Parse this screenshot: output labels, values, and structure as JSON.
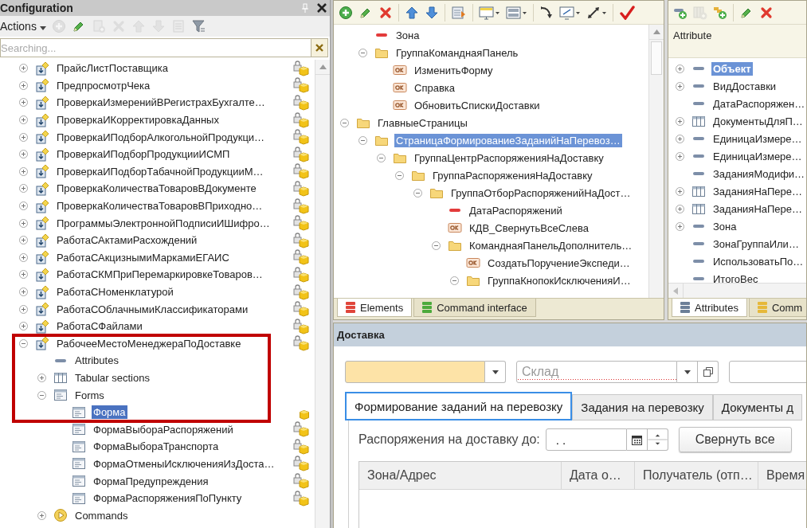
{
  "config_panel": {
    "title": "Configuration",
    "actions_label": "Actions",
    "toolbar": [
      {
        "kind": "add",
        "disabled": true
      },
      {
        "kind": "edit",
        "disabled": false
      },
      {
        "kind": "copy",
        "disabled": true
      },
      {
        "kind": "delete",
        "disabled": true
      },
      {
        "kind": "up",
        "disabled": true
      },
      {
        "kind": "down",
        "disabled": true
      },
      {
        "kind": "list",
        "disabled": true
      },
      {
        "kind": "filter",
        "disabled": false
      }
    ],
    "search": {
      "placeholder": "Searching..."
    },
    "tree": [
      {
        "label": "ПрайсЛистПоставщика",
        "kind": "processor",
        "expanded": false,
        "locked": true,
        "selected": false
      },
      {
        "label": "ПредпросмотрЧека",
        "kind": "processor",
        "expanded": false,
        "locked": true,
        "selected": false
      },
      {
        "label": "ПроверкаИзмеренийВРегистрахБухгалте…",
        "kind": "processor",
        "expanded": false,
        "locked": true,
        "selected": false
      },
      {
        "label": "ПроверкаИКорректировкаДанных",
        "kind": "processor",
        "expanded": false,
        "locked": true,
        "selected": false
      },
      {
        "label": "ПроверкаИПодборАлкогольнойПродукци…",
        "kind": "processor",
        "expanded": false,
        "locked": true,
        "selected": false
      },
      {
        "label": "ПроверкаИПодборПродукцииИСМП",
        "kind": "processor",
        "expanded": false,
        "locked": true,
        "selected": false
      },
      {
        "label": "ПроверкаИПодборТабачнойПродукцииМ…",
        "kind": "processor",
        "expanded": false,
        "locked": true,
        "selected": false
      },
      {
        "label": "ПроверкаКоличестваТоваровВДокументе",
        "kind": "processor",
        "expanded": false,
        "locked": true,
        "selected": false
      },
      {
        "label": "ПроверкаКоличестваТоваровВПриходно…",
        "kind": "processor",
        "expanded": false,
        "locked": true,
        "selected": false
      },
      {
        "label": "ПрограммыЭлектроннойПодписиИШифро…",
        "kind": "processor",
        "expanded": false,
        "locked": true,
        "selected": false
      },
      {
        "label": "РаботаСАктамиРасхождений",
        "kind": "processor",
        "expanded": false,
        "locked": true,
        "selected": false
      },
      {
        "label": "РаботаСАкцизнымиМаркамиЕГАИС",
        "kind": "processor",
        "expanded": false,
        "locked": true,
        "selected": false
      },
      {
        "label": "РаботаСКМПриПеремаркировкеТоваров…",
        "kind": "processor",
        "expanded": false,
        "locked": true,
        "selected": false
      },
      {
        "label": "РаботаСНоменклатурой",
        "kind": "processor",
        "expanded": false,
        "locked": true,
        "selected": false
      },
      {
        "label": "РаботаСОблачнымиКлассификаторами",
        "kind": "processor",
        "expanded": false,
        "locked": true,
        "selected": false
      },
      {
        "label": "РаботаСФайлами",
        "kind": "processor",
        "expanded": false,
        "locked": true,
        "selected": false
      },
      {
        "label": "РабочееМестоМенеджераПоДоставке",
        "kind": "processor",
        "expanded": true,
        "locked": true,
        "selected": false,
        "children": [
          {
            "label": "Attributes",
            "kind": "attribute",
            "selected": false
          },
          {
            "label": "Tabular sections",
            "kind": "table",
            "expanded": false,
            "selected": false
          },
          {
            "label": "Forms",
            "kind": "form",
            "expanded": true,
            "selected": false,
            "children": [
              {
                "label": "Форма",
                "kind": "form",
                "locked": false,
                "selected": true
              },
              {
                "label": "ФормаВыбораРаспоряжений",
                "kind": "form",
                "locked": true,
                "selected": false
              },
              {
                "label": "ФормаВыбораТранспорта",
                "kind": "form",
                "locked": true,
                "selected": false
              },
              {
                "label": "ФормаОтменыИсключенияИзДоста…",
                "kind": "form",
                "locked": true,
                "selected": false
              },
              {
                "label": "ФормаПредупреждения",
                "kind": "form",
                "locked": true,
                "selected": false
              },
              {
                "label": "ФормаРаспоряженияПоПункту",
                "kind": "form",
                "locked": true,
                "selected": false
              }
            ]
          },
          {
            "label": "Commands",
            "kind": "commands",
            "expanded": false,
            "selected": false
          }
        ]
      }
    ]
  },
  "elements_panel": {
    "toolbar": [
      {
        "kind": "add",
        "disabled": false
      },
      {
        "kind": "edit",
        "disabled": false
      },
      {
        "kind": "delete",
        "disabled": false
      },
      {
        "kind": "separator"
      },
      {
        "kind": "up",
        "disabled": false
      },
      {
        "kind": "down",
        "disabled": false
      },
      {
        "kind": "separator"
      },
      {
        "kind": "form",
        "disabled": false
      },
      {
        "kind": "separator"
      },
      {
        "kind": "monitor",
        "disabled": false
      },
      {
        "kind": "layout",
        "disabled": false
      },
      {
        "kind": "separator"
      },
      {
        "kind": "curve",
        "disabled": false
      },
      {
        "kind": "resize",
        "disabled": false
      },
      {
        "kind": "diagonal",
        "disabled": false
      },
      {
        "kind": "separator"
      },
      {
        "kind": "check",
        "disabled": false
      }
    ],
    "tree": [
      {
        "children": [
          {
            "label": "Зона",
            "kind": "field",
            "selected": false
          },
          {
            "label": "ГруппаКоманднаяПанель",
            "kind": "folder",
            "expanded": true,
            "selected": false,
            "children": [
              {
                "label": "ИзменитьФорму",
                "kind": "button",
                "selected": false
              },
              {
                "label": "Справка",
                "kind": "button",
                "selected": false
              },
              {
                "label": "ОбновитьСпискиДоставки",
                "kind": "button",
                "selected": false
              }
            ]
          }
        ]
      },
      {
        "label": "ГлавныеСтраницы",
        "kind": "folder",
        "expanded": true,
        "selected": false,
        "children": [
          {
            "label": "СтраницаФормированиеЗаданийНаПеревоз…",
            "kind": "folder",
            "expanded": true,
            "selected": true,
            "children": [
              {
                "label": "ГруппаЦентрРаспоряженияНаДоставку",
                "kind": "folder",
                "expanded": true,
                "selected": false,
                "children": [
                  {
                    "label": "ГруппаРаспоряженияНаДоставку",
                    "kind": "folder",
                    "expanded": true,
                    "selected": false,
                    "children": [
                      {
                        "label": "ГруппаОтборРаспоряженийНаДост…",
                        "kind": "folder",
                        "expanded": true,
                        "selected": false,
                        "children": [
                          {
                            "label": "ДатаРаспоряжений",
                            "kind": "field",
                            "selected": false
                          },
                          {
                            "label": "КДВ_СвернутьВсеСлева",
                            "kind": "button",
                            "selected": false
                          },
                          {
                            "label": "КоманднаяПанельДополнитель…",
                            "kind": "folder",
                            "expanded": true,
                            "selected": false,
                            "children": [
                              {
                                "label": "СоздатьПоручениеЭкспеди…",
                                "kind": "button",
                                "selected": false
                              },
                              {
                                "label": "ГруппаКнопокИсключенияИ…",
                                "kind": "folder",
                                "expanded": true,
                                "selected": false
                              }
                            ]
                          }
                        ]
                      }
                    ]
                  }
                ]
              }
            ]
          }
        ]
      }
    ],
    "tabs": [
      {
        "label": "Elements",
        "kind": "elements",
        "selected": true
      },
      {
        "label": "Command interface",
        "kind": "command_interface",
        "selected": false
      }
    ]
  },
  "attributes_panel": {
    "toolbar": [
      {
        "kind": "add_attribute",
        "disabled": false
      },
      {
        "kind": "add_table",
        "disabled": true
      },
      {
        "kind": "add_group",
        "disabled": false
      },
      {
        "kind": "separator"
      },
      {
        "kind": "edit",
        "disabled": false
      },
      {
        "kind": "delete",
        "disabled": false
      }
    ],
    "column": "Attribute",
    "tree": [
      {
        "label": "Объект",
        "kind": "attribute",
        "expanded": false,
        "main": true,
        "selected": true
      },
      {
        "label": "ВидДоставки",
        "kind": "attribute",
        "expanded": false,
        "main": false,
        "selected": false
      },
      {
        "label": "ДатаРаспоряжен…",
        "kind": "attribute",
        "main": false,
        "selected": false
      },
      {
        "label": "ДокументыДляП…",
        "kind": "table",
        "expanded": false,
        "main": false,
        "selected": false
      },
      {
        "label": "ЕдиницаИзмере…",
        "kind": "attribute",
        "expanded": false,
        "main": false,
        "selected": false
      },
      {
        "label": "ЕдиницаИзмере…",
        "kind": "attribute",
        "expanded": false,
        "main": false,
        "selected": false
      },
      {
        "label": "ЗаданияМодифи…",
        "kind": "attribute",
        "main": false,
        "selected": false
      },
      {
        "label": "ЗаданияНаПере…",
        "kind": "table",
        "expanded": false,
        "main": false,
        "selected": false
      },
      {
        "label": "ЗаданияНаПере…",
        "kind": "table",
        "expanded": false,
        "main": false,
        "selected": false
      },
      {
        "label": "Зона",
        "kind": "attribute",
        "expanded": false,
        "main": false,
        "selected": false
      },
      {
        "label": "ЗонаГруппаИли…",
        "kind": "attribute",
        "main": false,
        "selected": false
      },
      {
        "label": "ИспользоватьПо…",
        "kind": "attribute",
        "main": false,
        "selected": false
      },
      {
        "label": "ИтогоВес",
        "kind": "attribute",
        "main": false,
        "selected": false
      }
    ],
    "tabs": [
      {
        "label": "Attributes",
        "kind": "attributes",
        "selected": true
      },
      {
        "label": "Comm",
        "kind": "commands",
        "selected": false
      }
    ]
  },
  "form_preview": {
    "title": "Доставка",
    "fields": [
      {
        "kind": "select",
        "highlighted": true,
        "incomplete": false
      },
      {
        "kind": "select_open",
        "placeholder": "Склад",
        "highlighted": false,
        "incomplete": true
      },
      {
        "kind": "plain",
        "highlighted": false,
        "incomplete": false
      }
    ],
    "tabs": [
      {
        "label": "Формирование заданий на перевозку",
        "selected": true
      },
      {
        "label": "Задания на перевозку",
        "selected": false
      },
      {
        "label": "Документы д",
        "selected": false
      }
    ],
    "date_filter": {
      "label": "Распоряжения на доставку до:",
      "value": ". ."
    },
    "collapse_button": "Свернуть все",
    "table": {
      "columns": [
        "Зона/Адрес",
        "Дата о…",
        "Получатель (отп…",
        "Время"
      ]
    }
  }
}
